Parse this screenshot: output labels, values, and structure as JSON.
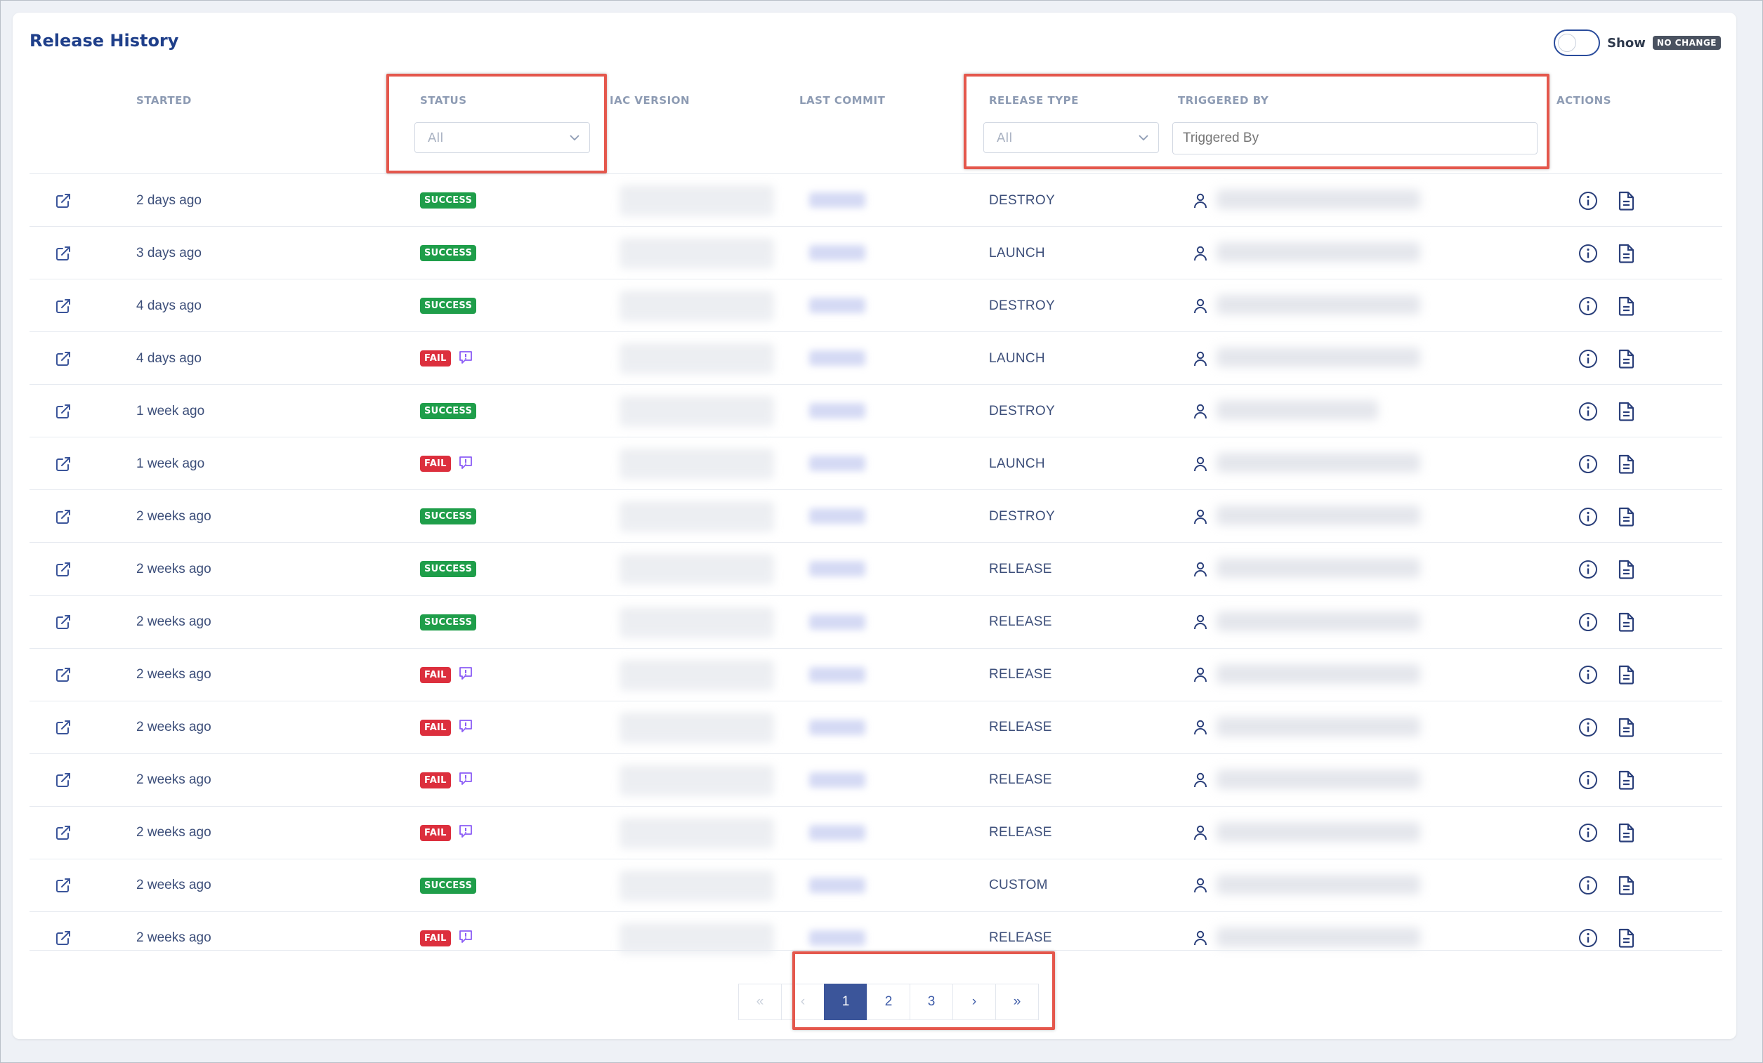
{
  "page": {
    "title": "Release History",
    "toggle": {
      "label": "Show",
      "badge": "NO CHANGE",
      "on": false
    }
  },
  "columns": {
    "started": "STARTED",
    "status": "STATUS",
    "iac_version": "IAC VERSION",
    "last_commit": "LAST COMMIT",
    "release_type": "RELEASE TYPE",
    "triggered_by": "TRIGGERED BY",
    "actions": "ACTIONS"
  },
  "filters": {
    "status_value": "All",
    "release_type_value": "All",
    "triggered_by_placeholder": "Triggered By"
  },
  "rows": [
    {
      "started": "2 days ago",
      "status": "SUCCESS",
      "release_type": "DESTROY"
    },
    {
      "started": "3 days ago",
      "status": "SUCCESS",
      "release_type": "LAUNCH"
    },
    {
      "started": "4 days ago",
      "status": "SUCCESS",
      "release_type": "DESTROY"
    },
    {
      "started": "4 days ago",
      "status": "FAIL",
      "release_type": "LAUNCH"
    },
    {
      "started": "1 week ago",
      "status": "SUCCESS",
      "release_type": "DESTROY"
    },
    {
      "started": "1 week ago",
      "status": "FAIL",
      "release_type": "LAUNCH"
    },
    {
      "started": "2 weeks ago",
      "status": "SUCCESS",
      "release_type": "DESTROY"
    },
    {
      "started": "2 weeks ago",
      "status": "SUCCESS",
      "release_type": "RELEASE"
    },
    {
      "started": "2 weeks ago",
      "status": "SUCCESS",
      "release_type": "RELEASE"
    },
    {
      "started": "2 weeks ago",
      "status": "FAIL",
      "release_type": "RELEASE"
    },
    {
      "started": "2 weeks ago",
      "status": "FAIL",
      "release_type": "RELEASE"
    },
    {
      "started": "2 weeks ago",
      "status": "FAIL",
      "release_type": "RELEASE"
    },
    {
      "started": "2 weeks ago",
      "status": "FAIL",
      "release_type": "RELEASE"
    },
    {
      "started": "2 weeks ago",
      "status": "SUCCESS",
      "release_type": "CUSTOM"
    },
    {
      "started": "2 weeks ago",
      "status": "FAIL",
      "release_type": "RELEASE"
    }
  ],
  "pagination": {
    "first": "«",
    "prev": "‹",
    "pages": [
      "1",
      "2",
      "3"
    ],
    "current": "1",
    "next": "›",
    "last": "»"
  },
  "colors": {
    "success": "#1f9e4a",
    "fail": "#dc2f3d",
    "accent": "#3b559a",
    "highlight": "#e4574c"
  }
}
